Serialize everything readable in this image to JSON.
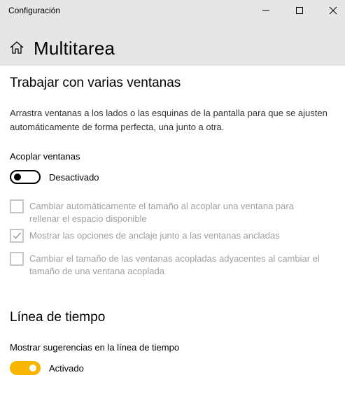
{
  "window": {
    "title": "Configuración",
    "icons": {
      "minimize": "minimize-icon",
      "maximize": "maximize-icon",
      "close": "close-icon"
    }
  },
  "header": {
    "home_icon": "home-icon",
    "title": "Multitarea"
  },
  "snap_section": {
    "title": "Trabajar con varias ventanas",
    "description": "Arrastra ventanas a los lados o las esquinas de la pantalla para que se ajusten automáticamente de forma perfecta, una junto a otra.",
    "toggle_label": "Acoplar ventanas",
    "toggle_state": "Desactivado",
    "toggle_on": false,
    "options": [
      {
        "label": "Cambiar automáticamente el tamaño al acoplar una ventana para rellenar el espacio disponible",
        "checked": false,
        "enabled": false
      },
      {
        "label": "Mostrar las opciones de anclaje junto a las ventanas ancladas",
        "checked": true,
        "enabled": false
      },
      {
        "label": "Cambiar el tamaño de las ventanas acopladas adyacentes al cambiar el tamaño de una ventana acoplada",
        "checked": false,
        "enabled": false
      }
    ]
  },
  "timeline_section": {
    "title": "Línea de tiempo",
    "toggle_label": "Mostrar sugerencias en la línea de tiempo",
    "toggle_state": "Activado",
    "toggle_on": true
  },
  "colors": {
    "accent": "#f7b500",
    "header_bg": "#e6e6e6",
    "disabled_text": "#a0a0a0"
  }
}
